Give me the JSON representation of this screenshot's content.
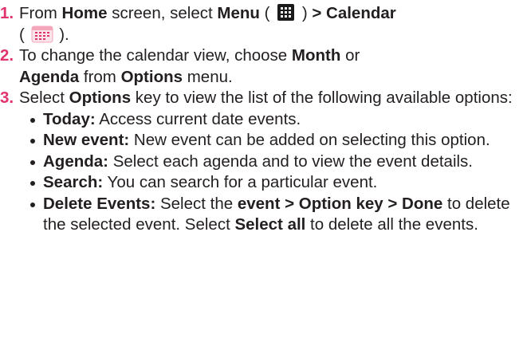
{
  "steps": [
    {
      "number": "1.",
      "parts": [
        "From ",
        "Home",
        " screen, select ",
        "Menu",
        " ( ",
        " ) ",
        "> Calendar",
        " ( ",
        " )."
      ]
    },
    {
      "number": "2.",
      "parts": [
        "To change the calendar view, choose ",
        "Month",
        " or ",
        "Agenda",
        " from ",
        "Options",
        " menu."
      ]
    },
    {
      "number": "3.",
      "parts": [
        "Select ",
        "Options",
        " key to view the list of the following available options:"
      ]
    }
  ],
  "options": [
    {
      "term": "Today:",
      "desc": " Access current date events."
    },
    {
      "term": "New event:",
      "desc": " New event can be added on selecting this option."
    },
    {
      "term": "Agenda:",
      "desc": " Select each agenda and to view the event details."
    },
    {
      "term": "Search:",
      "desc": " You can search for a particular event."
    },
    {
      "term": "Delete Events:",
      "desc_parts": [
        " Select the ",
        "event > Option key > Done",
        " to delete the selected event. Select ",
        "Select all",
        " to delete all the events."
      ]
    }
  ],
  "icons": {
    "menu": "menu-grid-icon",
    "calendar": "calendar-icon"
  },
  "colors": {
    "step_number": "#e0336b",
    "text": "#231f20",
    "calendar_icon": "#f4a6bb"
  }
}
